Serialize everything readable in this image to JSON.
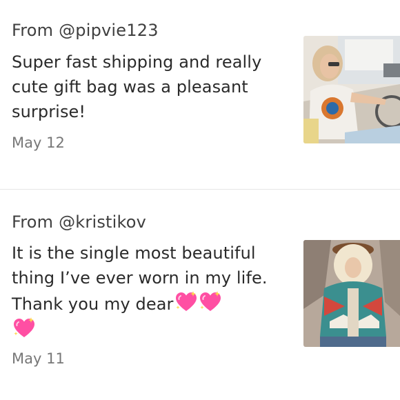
{
  "reviews": [
    {
      "author": "From @pipvie123",
      "text": "Super fast shipping and really cute gift bag was a pleasant surprise!",
      "date": "May 12",
      "photo_icon": "photo-thumbnail-icon"
    },
    {
      "author": "From @kristikov",
      "text": "It is the single most beautiful thing I’ve ever worn in my life. Thank you my dear",
      "emoji": [
        "💖",
        "💖",
        "💖"
      ],
      "emoji_icon": "sparkling-heart-icon",
      "date": "May 11",
      "photo_icon": "photo-thumbnail-icon"
    }
  ],
  "colors": {
    "text": "#2a2a2a",
    "author": "#3f3f3f",
    "date": "#777777",
    "divider": "#e6e6e6",
    "heart": "#ff4fa3"
  }
}
